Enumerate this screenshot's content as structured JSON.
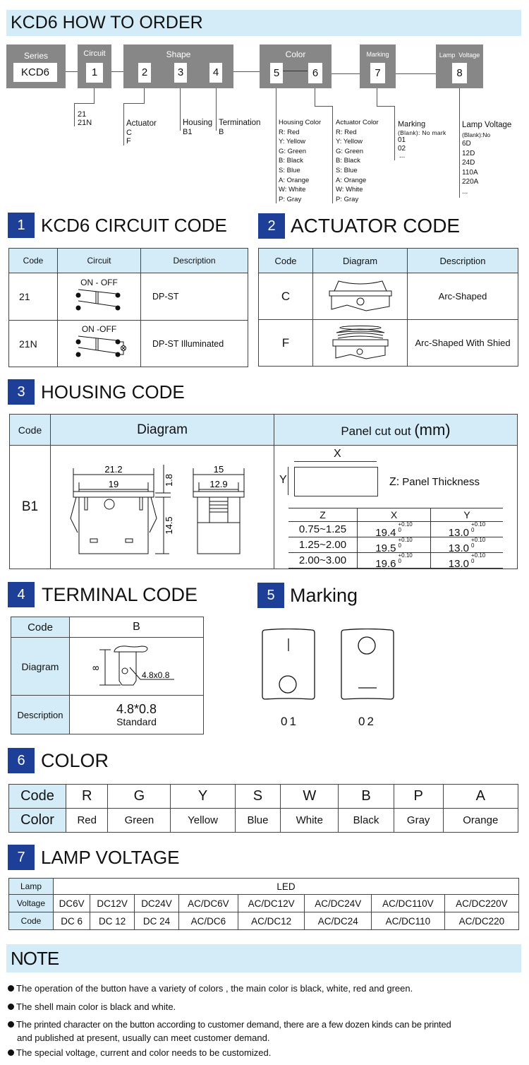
{
  "header": {
    "title": "KCD6 HOW TO ORDER"
  },
  "order_diagram": {
    "series": {
      "label": "Series",
      "value": "KCD6"
    },
    "circuit": {
      "label": "Circuit",
      "value": "1"
    },
    "shape": {
      "label": "Shape",
      "values": [
        "2",
        "3",
        "4"
      ]
    },
    "color": {
      "label": "Color",
      "values": [
        "5",
        "6"
      ]
    },
    "marking": {
      "label": "Marking",
      "value": "7"
    },
    "lamp_voltage": {
      "label": "Lamp  Voltage",
      "value": "8"
    },
    "circuit_options": [
      "21",
      "21N"
    ],
    "actuator_options": {
      "title": "Actuator",
      "items": [
        "C",
        "F"
      ]
    },
    "housing_options": {
      "title": "Housing",
      "items": [
        "B1"
      ]
    },
    "termination_options": {
      "title": "Termination",
      "items": [
        "B"
      ]
    },
    "housing_color": {
      "title": "Housing Color",
      "items": [
        "R:  Red",
        "Y:  Yellow",
        "G:  Green",
        "B:  Black",
        "S:  Blue",
        "A:  Orange",
        "W: White",
        "P:  Gray"
      ]
    },
    "actuator_color": {
      "title": "Actuator Color",
      "items": [
        "R:  Red",
        "Y:  Yellow",
        "G:  Green",
        "B:  Black",
        "S:  Blue",
        "A:  Orange",
        "W: White",
        "P:  Gray"
      ]
    },
    "marking_options": {
      "title": "Marking",
      "blank": "(Blank): No mark",
      "items": [
        "01",
        "02",
        "..."
      ]
    },
    "lamp_voltage_options": {
      "title": "Lamp Voltage",
      "blank": "(Blank):No",
      "items": [
        "6D",
        "12D",
        "24D",
        "110A",
        "220A",
        "..."
      ]
    }
  },
  "section1": {
    "num": "1",
    "title": "KCD6 CIRCUIT CODE",
    "headers": [
      "Code",
      "Circuit",
      "Description"
    ],
    "rows": [
      {
        "code": "21",
        "circuit_label": "ON - OFF",
        "description": "DP-ST"
      },
      {
        "code": "21N",
        "circuit_label": "ON -OFF",
        "description": "DP-ST Illuminated"
      }
    ]
  },
  "section2": {
    "num": "2",
    "title": "ACTUATOR CODE",
    "headers": [
      "Code",
      "Diagram",
      "Description"
    ],
    "rows": [
      {
        "code": "C",
        "description": "Arc-Shaped"
      },
      {
        "code": "F",
        "description": "Arc-Shaped With Shied"
      }
    ]
  },
  "section3": {
    "num": "3",
    "title": "HOUSING CODE",
    "headers": [
      "Code",
      "Diagram",
      "Panel cut out",
      "(mm)"
    ],
    "code": "B1",
    "dimensions": {
      "w_outer": "21.2",
      "w_inner": "19",
      "h_top": "1.8",
      "h_body": "14.5",
      "side_outer": "15",
      "side_inner": "12.9"
    },
    "cutout": {
      "x_label": "X",
      "y_label": "Y",
      "z_label": "Z:",
      "z_text": "Panel Thickness"
    },
    "cutout_table": {
      "headers": [
        "Z",
        "X",
        "Y"
      ],
      "tolerance_top": "+0.10",
      "tolerance_bottom": "0",
      "rows": [
        {
          "z": "0.75~1.25",
          "x": "19.4",
          "y": "13.0"
        },
        {
          "z": "1.25~2.00",
          "x": "19.5",
          "y": "13.0"
        },
        {
          "z": "2.00~3.00",
          "x": "19.6",
          "y": "13.0"
        }
      ]
    }
  },
  "section4": {
    "num": "4",
    "title": "TERMINAL CODE",
    "code_label": "Code",
    "code": "B",
    "diagram_label": "Diagram",
    "diagram_dim": "8",
    "diagram_size": "4.8x0.8",
    "description_label": "Description",
    "description_main": "4.8*0.8",
    "description_sub": "Standard"
  },
  "section5": {
    "num": "5",
    "title": "Marking",
    "items": [
      {
        "code": "01"
      },
      {
        "code": "02"
      }
    ]
  },
  "section6": {
    "num": "6",
    "title": "COLOR",
    "row_labels": [
      "Code",
      "Color"
    ],
    "codes": [
      "R",
      "G",
      "Y",
      "S",
      "W",
      "B",
      "P",
      "A"
    ],
    "colors": [
      "Red",
      "Green",
      "Yellow",
      "Blue",
      "White",
      "Black",
      "Gray",
      "Orange"
    ]
  },
  "section7": {
    "num": "7",
    "title": "LAMP VOLTAGE",
    "row_labels": [
      "Lamp",
      "Voltage",
      "Code"
    ],
    "lamp": "LED",
    "voltages": [
      "DC6V",
      "DC12V",
      "DC24V",
      "AC/DC6V",
      "AC/DC12V",
      "AC/DC24V",
      "AC/DC110V",
      "AC/DC220V"
    ],
    "codes": [
      "DC 6",
      "DC 12",
      "DC 24",
      "AC/DC6",
      "AC/DC12",
      "AC/DC24",
      "AC/DC110",
      "AC/DC220"
    ]
  },
  "note": {
    "title": "NOTE",
    "items": [
      "The operation of the button have a variety of colors , the main color is black, white, red and green.",
      "The shell main color is black and white.",
      "The printed character on the button according to customer demand, there are a few dozen kinds can be printed",
      "and published at present,  usually can meet customer demand.",
      "The special voltage, current and color needs to be customized."
    ]
  },
  "colors": {
    "accent_blue": "#1d3f98",
    "header_light_blue": "#d4ecf8",
    "box_gray": "#878787"
  }
}
